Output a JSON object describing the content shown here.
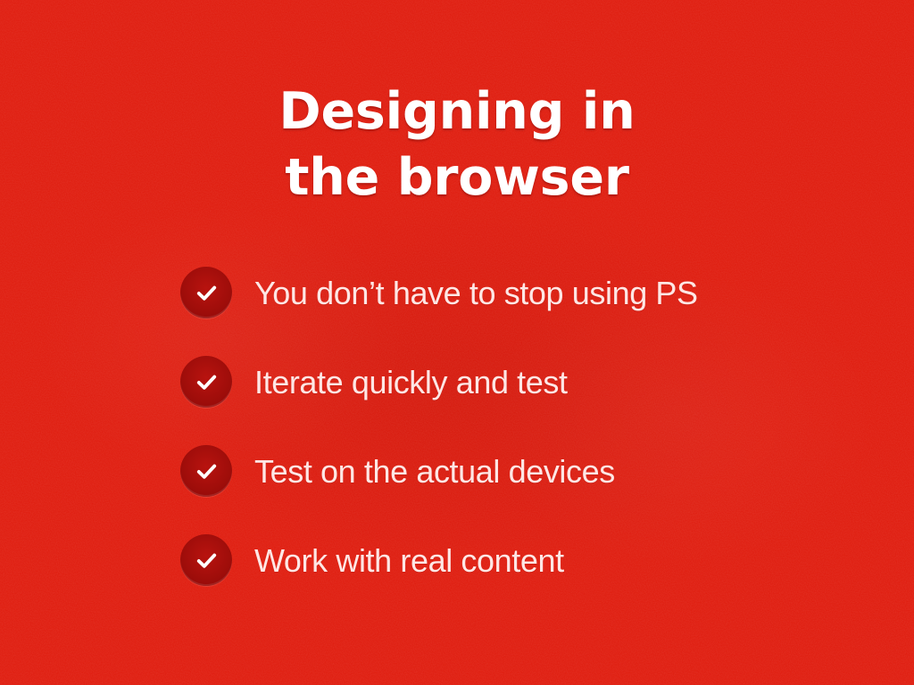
{
  "slide": {
    "title_line_1": "Designing in",
    "title_line_2": "the browser",
    "background_color": "#df1a0c",
    "text_color": "#ffe7e5",
    "checkmark_circle_color": "#a10f0b",
    "checkmark_icon": "check-icon",
    "items": [
      {
        "label": "You don’t have to stop using PS"
      },
      {
        "label": "Iterate quickly and test"
      },
      {
        "label": "Test on the actual devices"
      },
      {
        "label": "Work with real content"
      }
    ]
  }
}
